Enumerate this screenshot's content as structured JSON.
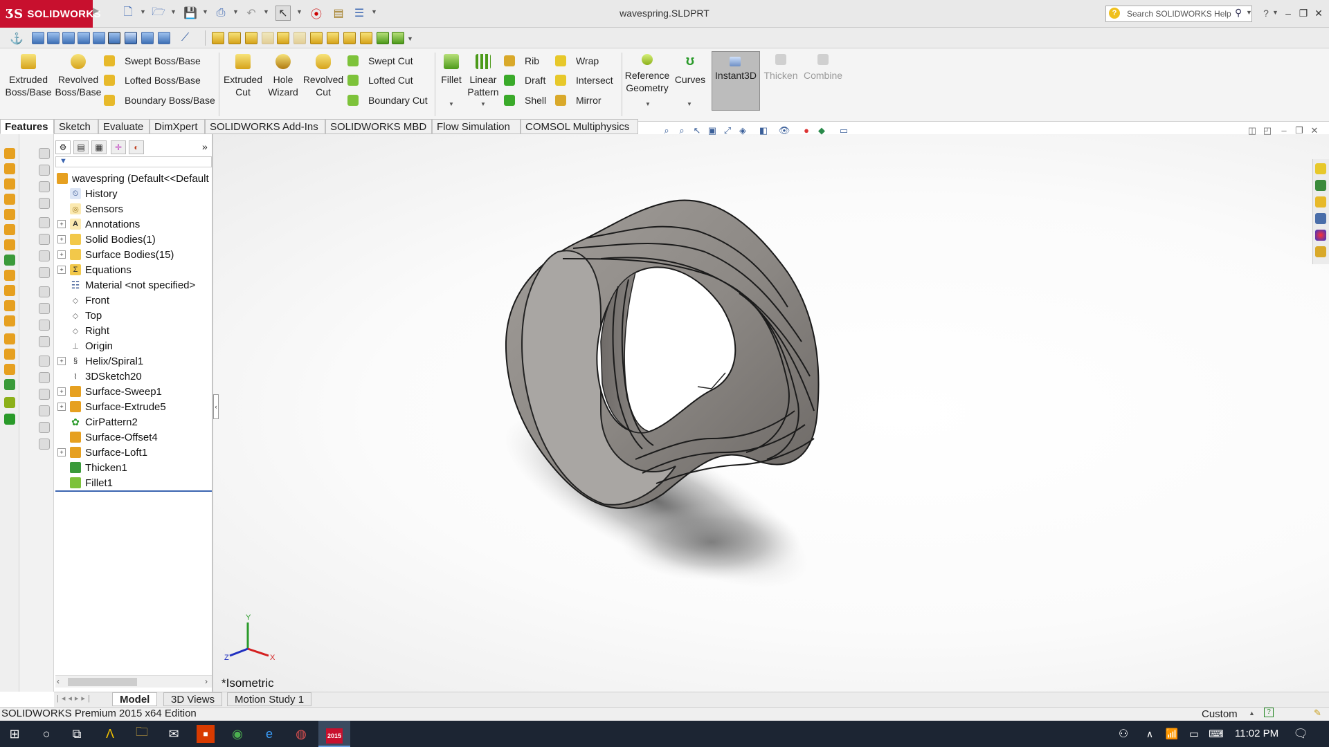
{
  "app": {
    "brand": "SOLIDWORKS",
    "document_title": "wavespring.SLDPRT",
    "help_search_placeholder": "Search SOLIDWORKS Help"
  },
  "command_manager": {
    "big_buttons": [
      {
        "line1": "Extruded",
        "line2": "Boss/Base"
      },
      {
        "line1": "Revolved",
        "line2": "Boss/Base"
      },
      {
        "line1": "Extruded",
        "line2": "Cut"
      },
      {
        "line1": "Hole",
        "line2": "Wizard"
      },
      {
        "line1": "Revolved",
        "line2": "Cut"
      },
      {
        "line1": "Fillet",
        "line2": ""
      },
      {
        "line1": "Linear",
        "line2": "Pattern"
      },
      {
        "line1": "Reference",
        "line2": "Geometry"
      },
      {
        "line1": "Curves",
        "line2": ""
      },
      {
        "line1": "Instant3D",
        "line2": ""
      },
      {
        "line1": "Thicken",
        "line2": ""
      },
      {
        "line1": "Combine",
        "line2": ""
      }
    ],
    "boss_small": [
      "Swept Boss/Base",
      "Lofted Boss/Base",
      "Boundary Boss/Base"
    ],
    "cut_small": [
      "Swept Cut",
      "Lofted Cut",
      "Boundary Cut"
    ],
    "feature_small_1": [
      "Rib",
      "Draft",
      "Shell"
    ],
    "feature_small_2": [
      "Wrap",
      "Intersect",
      "Mirror"
    ]
  },
  "tabs": [
    "Features",
    "Sketch",
    "Evaluate",
    "DimXpert",
    "SOLIDWORKS Add-Ins",
    "SOLIDWORKS MBD",
    "Flow Simulation",
    "COMSOL Multiphysics"
  ],
  "tree": {
    "root": "wavespring  (Default<<Default",
    "items": [
      {
        "label": "History",
        "expandable": false
      },
      {
        "label": "Sensors",
        "expandable": false
      },
      {
        "label": "Annotations",
        "expandable": true
      },
      {
        "label": "Solid Bodies(1)",
        "expandable": true
      },
      {
        "label": "Surface Bodies(15)",
        "expandable": true
      },
      {
        "label": "Equations",
        "expandable": true
      },
      {
        "label": "Material <not specified>",
        "expandable": false
      },
      {
        "label": "Front",
        "expandable": false
      },
      {
        "label": "Top",
        "expandable": false
      },
      {
        "label": "Right",
        "expandable": false
      },
      {
        "label": "Origin",
        "expandable": false
      },
      {
        "label": "Helix/Spiral1",
        "expandable": true
      },
      {
        "label": "3DSketch20",
        "expandable": false
      },
      {
        "label": "Surface-Sweep1",
        "expandable": true
      },
      {
        "label": "Surface-Extrude5",
        "expandable": true
      },
      {
        "label": "CirPattern2",
        "expandable": false
      },
      {
        "label": "Surface-Offset4",
        "expandable": false
      },
      {
        "label": "Surface-Loft1",
        "expandable": true
      },
      {
        "label": "Thicken1",
        "expandable": false
      },
      {
        "label": "Fillet1",
        "expandable": false
      }
    ]
  },
  "viewport": {
    "view_name": "*Isometric",
    "triad": {
      "x": "X",
      "y": "Y",
      "z": "Z"
    }
  },
  "bottom_tabs": [
    "Model",
    "3D Views",
    "Motion Study 1"
  ],
  "status": {
    "edition": "SOLIDWORKS Premium 2015 x64 Edition",
    "units": "Custom"
  },
  "taskbar": {
    "time": "11:02 PM",
    "sw_badge": "2015"
  },
  "colors": {
    "brand_red": "#c8102e",
    "taskbar": "#1c2533",
    "selection_blue": "#3a64b0"
  }
}
